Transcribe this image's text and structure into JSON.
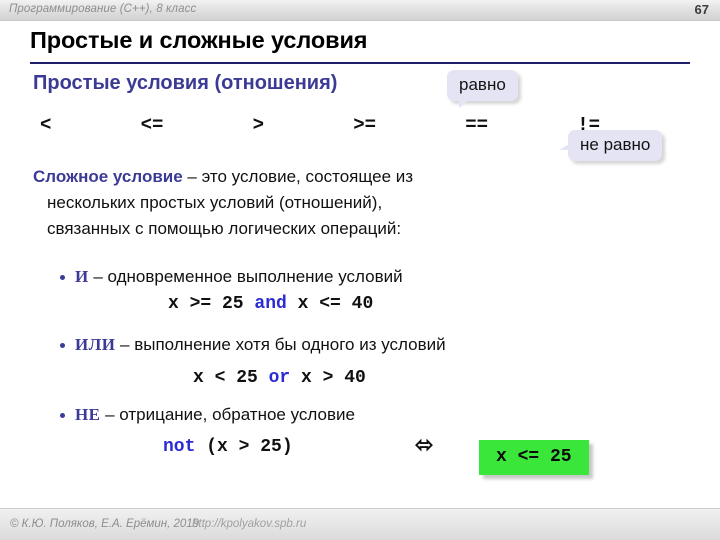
{
  "header": {
    "course_title": "Программирование (C++), 8 класс",
    "page_number": "67"
  },
  "title": "Простые и сложные условия",
  "simple_conditions": {
    "heading": "Простые условия (отношения)",
    "operators": [
      "<",
      "<=",
      ">",
      ">=",
      "==",
      "!="
    ],
    "callouts": {
      "equal": "равно",
      "not_equal": "не равно"
    }
  },
  "complex_condition": {
    "term": "Сложное условие",
    "definition_line1": " – это условие, состоящее из",
    "definition_line2": "нескольких простых условий (отношений),",
    "definition_line3": "связанных с помощью логических операций:"
  },
  "bullets": [
    {
      "keyword": "И",
      "text": " – одновременное выполнение условий",
      "code_before": "x >= 25 ",
      "code_op": "and",
      "code_after": " x <= 40"
    },
    {
      "keyword": "ИЛИ",
      "text": " – выполнение хотя бы одного из условий",
      "code_before": "x < 25 ",
      "code_op": "or",
      "code_after": " x > 40"
    },
    {
      "keyword": "НЕ",
      "text": " – отрицание, обратное условие",
      "code_before": "",
      "code_op": "not",
      "code_after": " (x > 25)"
    }
  ],
  "equivalence_symbol": "⬄",
  "result_box": "x <= 25",
  "footer": {
    "copyright": "© К.Ю. Поляков, Е.А. Ерёмин, 2019",
    "url": "http://kpolyakov.spb.ru"
  },
  "colors": {
    "accent_blue": "#3b3b96",
    "rule_blue": "#1f1f6b",
    "code_keyword": "#2b2bd4",
    "callout_bg": "#e4e4f4",
    "result_green": "#3ae63a"
  }
}
